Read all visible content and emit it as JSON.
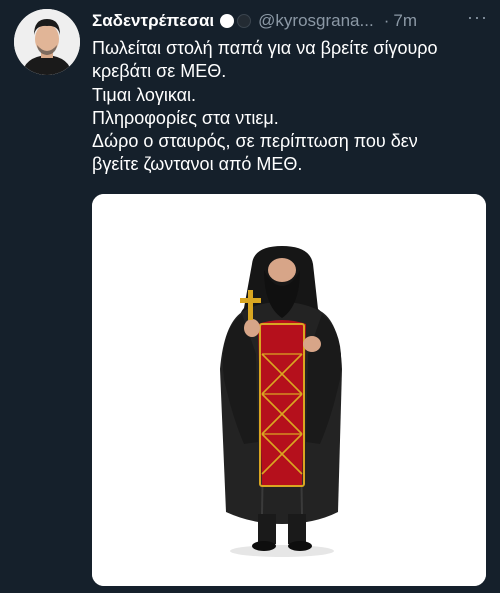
{
  "tweet": {
    "author_name": "Σαδεντρέπεσαι",
    "handle": "@kyrosgrana...",
    "separator": "·",
    "time": "7m",
    "more_icon": "more-horizontal-icon",
    "text_lines": [
      "Πωλείται στολή παπά για να βρείτε σίγουρο",
      "κρεβάτι σε ΜΕΘ.",
      "Τιμαι λογικαι.",
      "Πληροφορίες στα ντιεμ.",
      "Δώρο ο σταυρός, σε περίπτωση που δεν",
      "βγείτε ζωντανοι από ΜΕΘ."
    ]
  },
  "colors": {
    "background": "#15202b",
    "text": "#ffffff",
    "secondary_text": "#8b98a5",
    "robe": "#1e1e1e",
    "stole": "#b5101c",
    "gold": "#d9a621"
  }
}
